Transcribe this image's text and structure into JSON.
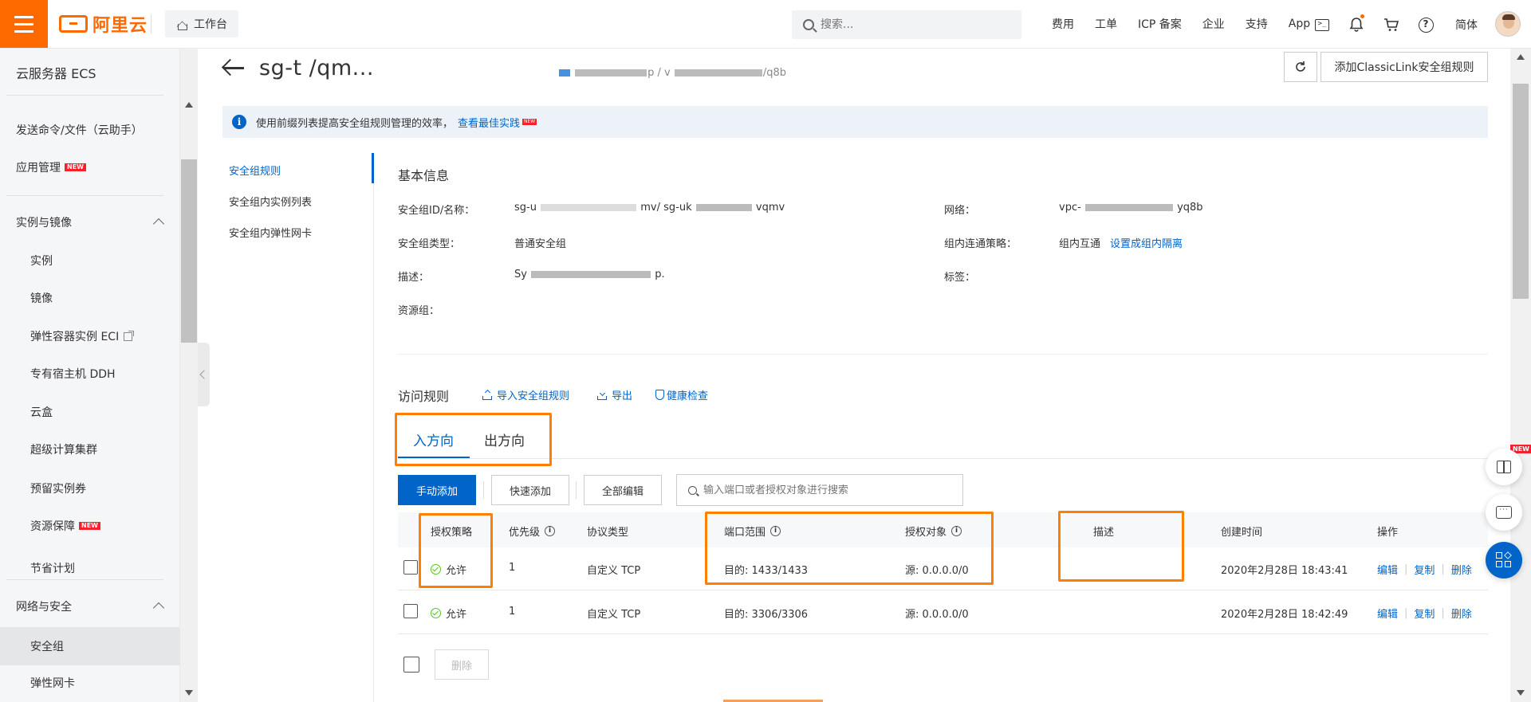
{
  "topbar": {
    "logo": "阿里云",
    "workbench": "工作台",
    "search_placeholder": "搜索...",
    "nav": [
      "费用",
      "工单",
      "ICP 备案",
      "企业",
      "支持",
      "App"
    ],
    "lang": "简体",
    "icons": [
      "menu-icon",
      "home-icon",
      "search-icon",
      "terminal-icon",
      "bell-icon",
      "cart-icon",
      "help-icon",
      "avatar"
    ]
  },
  "sidebar": {
    "title": "云服务器 ECS",
    "items": [
      {
        "label": "发送命令/文件（云助手）"
      },
      {
        "label": "应用管理",
        "badge": "NEW"
      },
      {
        "label": "实例与镜像",
        "group": true
      },
      {
        "label": "实例"
      },
      {
        "label": "镜像"
      },
      {
        "label": "弹性容器实例 ECI"
      },
      {
        "label": "专有宿主机 DDH"
      },
      {
        "label": "云盒"
      },
      {
        "label": "超级计算集群"
      },
      {
        "label": "预留实例券"
      },
      {
        "label": "资源保障",
        "badge": "NEW"
      },
      {
        "label": "节省计划"
      },
      {
        "label": "网络与安全",
        "group": true
      },
      {
        "label": "安全组",
        "active": true
      },
      {
        "label": "弹性网卡"
      }
    ]
  },
  "header": {
    "title": "sg-t         /qm...",
    "subtitle_left": "p / v",
    "subtitle_right": "/q8b",
    "classic_button": "添加ClassicLink安全组规则"
  },
  "tip": {
    "text": "使用前缀列表提高安全组规则管理的效率，",
    "link": "查看最佳实践",
    "badge": "NEW"
  },
  "subnav": [
    "安全组规则",
    "安全组内实例列表",
    "安全组内弹性网卡"
  ],
  "basic_info": {
    "title": "基本信息",
    "id_label": "安全组ID/名称：",
    "id_value_a": "sg-u",
    "id_value_b": "mv/ sg-uk",
    "id_value_c": "vqmv",
    "type_label": "安全组类型：",
    "type_value": "普通安全组",
    "desc_label": "描述：",
    "desc_value_a": "Sy",
    "desc_value_b": "p.",
    "rg_label": "资源组：",
    "net_label": "网络：",
    "net_value_a": "vpc-",
    "net_value_b": "yq8b",
    "policy_label": "组内连通策略：",
    "policy_value": "组内互通",
    "policy_link": "设置成组内隔离",
    "tag_label": "标签："
  },
  "rules": {
    "title": "访问规则",
    "import": "导入安全组规则",
    "export": "导出",
    "health": "健康检查",
    "tabs": [
      "入方向",
      "出方向"
    ],
    "buttons": {
      "manual_add": "手动添加",
      "quick_add": "快速添加",
      "edit_all": "全部编辑"
    },
    "search_placeholder": "输入端口或者授权对象进行搜索",
    "columns": [
      "授权策略",
      "优先级",
      "协议类型",
      "端口范围",
      "授权对象",
      "描述",
      "创建时间",
      "操作"
    ],
    "rows": [
      {
        "policy": "允许",
        "priority": "1",
        "protocol": "自定义 TCP",
        "port": "目的: 1433/1433",
        "target": "源: 0.0.0.0/0",
        "desc": "",
        "created": "2020年2月28日 18:43:41"
      },
      {
        "policy": "允许",
        "priority": "1",
        "protocol": "自定义 TCP",
        "port": "目的: 3306/3306",
        "target": "源: 0.0.0.0/0",
        "desc": "",
        "created": "2020年2月28日 18:42:49"
      }
    ],
    "ops": [
      "编辑",
      "复制",
      "删除"
    ],
    "delete": "删除"
  },
  "float_badge": "NEW",
  "colors": {
    "brand": "#ff6a00",
    "primary": "#0064c8",
    "highlight": "#ff8000",
    "allow": "#52c41a"
  }
}
